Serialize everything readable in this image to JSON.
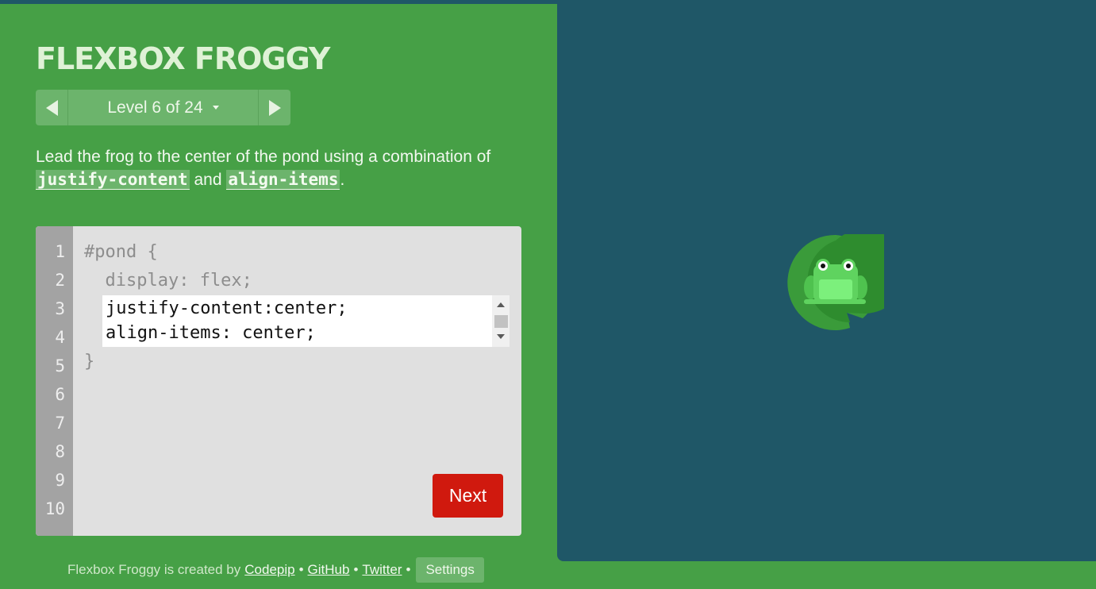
{
  "app": {
    "title": "FLEXBOX FROGGY"
  },
  "level": {
    "label": "Level 6 of 24",
    "prev_icon": "triangle-left-icon",
    "next_icon": "triangle-right-icon",
    "dropdown_icon": "caret-down-icon"
  },
  "instructions": {
    "text_before": "Lead the frog to the center of the pond using a combination of",
    "code1": "justify-content",
    "text_middle": "and",
    "code2": "align-items",
    "text_after": "."
  },
  "editor": {
    "line_numbers": [
      "1",
      "2",
      "3",
      "4",
      "5",
      "6",
      "7",
      "8",
      "9",
      "10"
    ],
    "line1": "#pond {",
    "line2": "  display: flex;",
    "line5": "}",
    "input_line1": "justify-content:center;",
    "input_line2": "align-items: center;",
    "next_label": "Next"
  },
  "footer": {
    "prefix": "Flexbox Froggy is created by",
    "link_codepip": "Codepip",
    "link_github": "GitHub",
    "link_twitter": "Twitter",
    "separator": "•",
    "settings_label": "Settings"
  },
  "colors": {
    "background": "#46a046",
    "pond": "#1f5767",
    "next_button": "#d0190e",
    "lilypad": "#3a9b3a",
    "frog": "#5fd35f"
  }
}
